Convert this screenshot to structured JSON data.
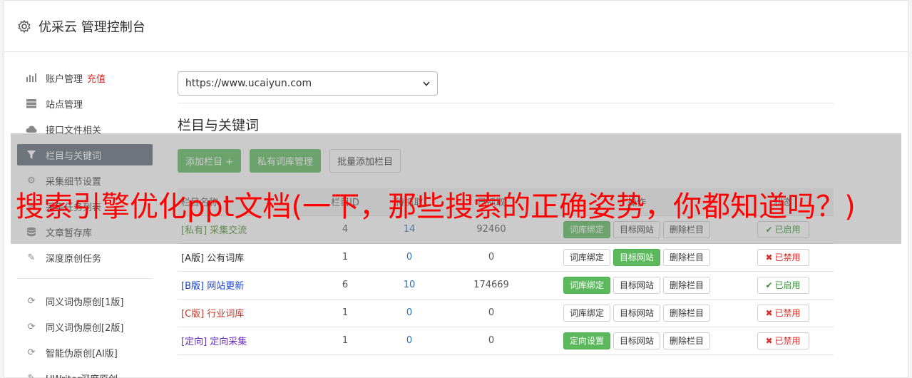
{
  "header": {
    "title": "优采云 管理控制台",
    "icon": "gear-icon"
  },
  "sidebar": {
    "items": [
      {
        "label": "账户管理",
        "extra": "充值",
        "icon": "bar-chart-icon"
      },
      {
        "label": "站点管理",
        "icon": "server-icon"
      },
      {
        "label": "接口文件相关",
        "icon": "cloud-upload-icon"
      },
      {
        "label": "栏目与关键词",
        "icon": "filter-icon",
        "active": true
      },
      {
        "label": "采集细节设置",
        "icon": "gears-icon"
      },
      {
        "label": "采集任务列表",
        "icon": "list-icon"
      },
      {
        "label": "文章暂存库",
        "icon": "database-icon"
      },
      {
        "label": "深度原创任务",
        "icon": "edit-icon"
      }
    ],
    "items2": [
      {
        "label": "同义词伪原创[1版]",
        "icon": "refresh-icon"
      },
      {
        "label": "同义词伪原创[2版]",
        "icon": "refresh-icon"
      },
      {
        "label": "智能伪原创[AI版]",
        "icon": "refresh-icon"
      },
      {
        "label": "UWriter深度原创",
        "icon": "edit-icon"
      }
    ]
  },
  "main": {
    "site_select": "https://www.ucaiyun.com",
    "section_title": "栏目与关键词",
    "buttons": {
      "add": "添加栏目 +",
      "private": "私有词库管理",
      "batch": "批量添加栏目"
    },
    "table": {
      "headers": [
        "栏目名称",
        "栏目ID",
        "待抓取",
        "已抓取",
        "操作",
        "状态"
      ],
      "rows": [
        {
          "tag": "[私有]",
          "name": "采集交流",
          "id": "4",
          "pending": "14",
          "done": "92460",
          "op1": "词库绑定",
          "op2": "目标网站",
          "op3": "删除栏目",
          "status": "已启用",
          "enabled": true
        },
        {
          "tag": "[A版]",
          "name": "公有词库",
          "id": "1",
          "pending": "0",
          "done": "0",
          "op1": "词库绑定",
          "op2": "目标网站",
          "op3": "删除栏目",
          "status": "已禁用",
          "enabled": false
        },
        {
          "tag": "[B版]",
          "name": "网站更新",
          "id": "6",
          "pending": "10",
          "done": "174669",
          "op1": "词库绑定",
          "op2": "目标网站",
          "op3": "删除栏目",
          "status": "已启用",
          "enabled": true
        },
        {
          "tag": "[C版]",
          "name": "行业词库",
          "id": "1",
          "pending": "0",
          "done": "0",
          "op1": "词库绑定",
          "op2": "目标网站",
          "op3": "删除栏目",
          "status": "已禁用",
          "enabled": false
        },
        {
          "tag": "[定向]",
          "name": "定向采集",
          "id": "1",
          "pending": "0",
          "done": "0",
          "op1": "定向设置",
          "op2": "目标网站",
          "op3": "删除栏目",
          "status": "已禁用",
          "enabled": false
        }
      ]
    }
  },
  "overlay": {
    "text": "搜索引擎优化ppt文档(一下，那些搜索的正确姿势，你都知道吗？)"
  },
  "colors": {
    "accent_green": "#5cb85c",
    "active_nav": "#5d6a77",
    "overlay_red": "#ff0000"
  }
}
